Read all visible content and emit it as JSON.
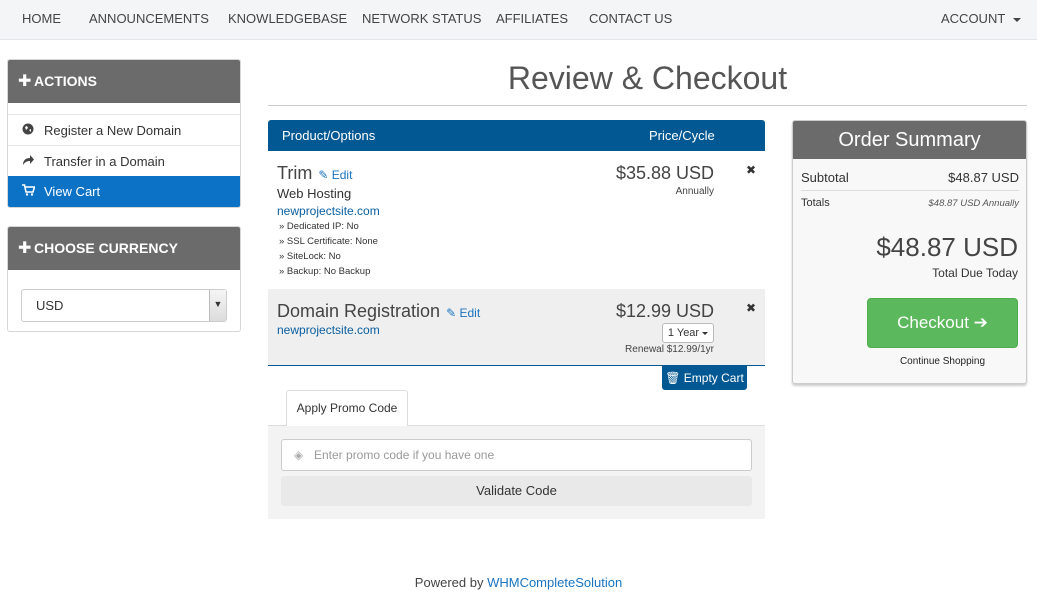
{
  "nav": {
    "items": [
      "HOME",
      "ANNOUNCEMENTS",
      "KNOWLEDGEBASE",
      "NETWORK STATUS",
      "AFFILIATES",
      "CONTACT US"
    ],
    "account": "ACCOUNT"
  },
  "sidebar": {
    "actions_title": "ACTIONS",
    "actions": [
      {
        "label": "Register a New Domain",
        "icon": "globe-icon"
      },
      {
        "label": "Transfer in a Domain",
        "icon": "share-arrow-icon"
      },
      {
        "label": "View Cart",
        "icon": "cart-icon"
      }
    ],
    "currency_title": "CHOOSE CURRENCY",
    "currency_value": "USD"
  },
  "main": {
    "title": "Review & Checkout",
    "header_product": "Product/Options",
    "header_price": "Price/Cycle",
    "edit_label": "Edit",
    "item1": {
      "name": "Trim",
      "group": "Web Hosting",
      "domain": "newprojectsite.com",
      "options": [
        "» Dedicated IP: No",
        "» SSL Certificate: None",
        "» SiteLock: No",
        "» Backup: No Backup"
      ],
      "price": "$35.88 USD",
      "cycle": "Annually"
    },
    "item2": {
      "name": "Domain Registration",
      "domain": "newprojectsite.com",
      "price": "$12.99 USD",
      "period": "1 Year",
      "renewal": "Renewal $12.99/1yr"
    },
    "empty_cart": "Empty Cart",
    "promo_tab": "Apply Promo Code",
    "promo_placeholder": "Enter promo code if you have one",
    "validate": "Validate Code"
  },
  "summary": {
    "title": "Order Summary",
    "subtotal_label": "Subtotal",
    "subtotal_value": "$48.87 USD",
    "totals_label": "Totals",
    "totals_value": "$48.87 USD Annually",
    "total_due": "$48.87 USD",
    "total_due_label": "Total Due Today",
    "checkout": "Checkout",
    "continue": "Continue Shopping"
  },
  "footer": {
    "prefix": "Powered by",
    "link": "WHMCompleteSolution"
  },
  "colors": {
    "primary": "#025892",
    "active": "#0c72c6",
    "success": "#5cb85c",
    "panel_head": "#6b6b6b"
  }
}
